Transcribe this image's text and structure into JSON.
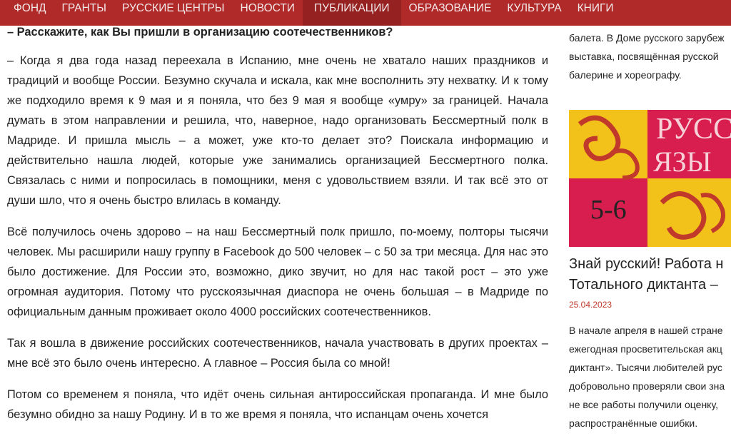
{
  "nav": {
    "items": [
      {
        "label": "ФОНД"
      },
      {
        "label": "ГРАНТЫ"
      },
      {
        "label": "РУССКИЕ ЦЕНТРЫ"
      },
      {
        "label": "НОВОСТИ"
      },
      {
        "label": "ПУБЛИКАЦИИ",
        "active": true
      },
      {
        "label": "ОБРАЗОВАНИЕ"
      },
      {
        "label": "КУЛЬТУРА"
      },
      {
        "label": "КНИГИ"
      }
    ]
  },
  "article": {
    "question": "– Расскажите, как Вы пришли в организацию соотечественников?",
    "paragraphs": [
      "– Когда я два года назад переехала в Испанию, мне очень не хватало наших праздников и традиций и вообще России. Безумно скучала и искала, как мне восполнить эту нехватку. И к тому же подходило время к 9 мая и я поняла, что без 9 мая я вообще «умру» за границей. Начала думать в этом направлении и решила, что, наверное, надо организовать Бессмертный полк в Мадриде. И пришла мысль – а может, уже кто-то делает это? Поискала информацию и действительно нашла людей, которые уже занимались организацией Бессмертного полка. Связалась с ними и попросилась в помощники, меня с удовольствием взяли. И так всё это от души шло, что я очень быстро влилась в команду.",
      "Всё получилось очень здорово – на наш Бессмертный полк пришло, по-моему, полторы тысячи человек. Мы расширили нашу группу в Facebook до 500 человек – с 50 за три месяца. Для нас это было достижение. Для России это, возможно, дико звучит, но для нас такой рост – это уже огромная аудитория. Потому что русскоязычная диаспора не очень большая – в Мадриде по официальным данным проживает около 4000 российских соотечественников.",
      "Так я вошла в движение российских соотечественников, начала участвовать в других проектах – мне всё это было очень интересно. А главное – Россия была со мной!",
      "Потом со временем я поняла, что идёт очень сильная антироссийская пропаганда. И мне было безумно обидно за нашу Родину. И в то же время я поняла, что испанцам очень хочется"
    ]
  },
  "sidebar": {
    "teaser_lines": [
      "балета. В Доме русского зарубеж",
      "выставка, посвящённая русской",
      "балерине и хореографу."
    ],
    "card": {
      "image_text": {
        "top": "РУСС",
        "middle": "ЯЗЫ",
        "bottom": "5-6"
      },
      "title_lines": [
        "Знай русский! Работа н",
        "Тотального диктанта –"
      ],
      "date": "25.04.2023",
      "desc_lines": [
        "В начале апреля в нашей стране",
        "ежегодная просветительская акц",
        "диктант». Тысячи любителей рус",
        "добровольно проверяли свои зна",
        "не все работы получили оценку,",
        "распространённые ошибки."
      ]
    }
  },
  "colors": {
    "nav_bg": "#b02a2a",
    "nav_active_bg": "#962121",
    "date": "#c0392b"
  }
}
